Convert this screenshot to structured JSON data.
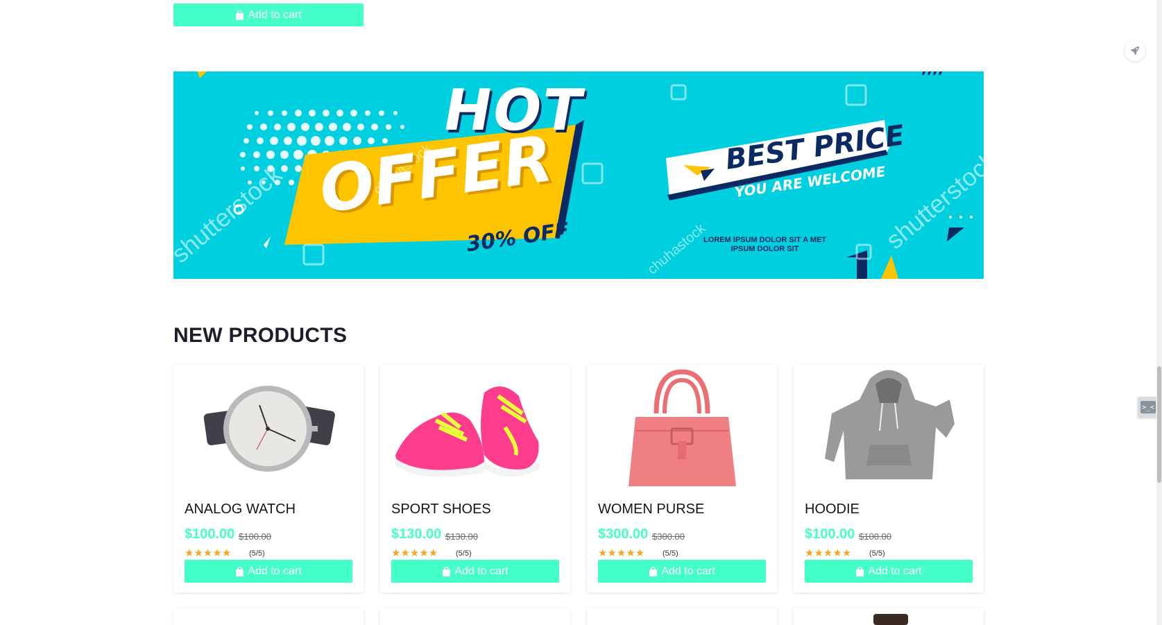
{
  "top_cart": {
    "label": "Add to cart"
  },
  "banner": {
    "hot": "HOT",
    "offer": "OFFER",
    "discount": "30% OFF",
    "best_price": "BEST PRICE",
    "welcome": "YOU ARE WELCOME",
    "lorem_line1": "LOREM IPSUM DOLOR SIT A MET",
    "lorem_line2": "IPSUM DOLOR SIT",
    "watermark_main": "shutterstock",
    "watermark_secondary": "chuhastock"
  },
  "section": {
    "title": "NEW PRODUCTS"
  },
  "products": [
    {
      "name": "ANALOG WATCH",
      "price": "$100.00",
      "old_price": "$100.00",
      "stars": "★★★★★",
      "rating": "(5/5)",
      "cart_label": "Add to cart",
      "image_icon": "watch-image"
    },
    {
      "name": "SPORT SHOES",
      "price": "$130.00",
      "old_price": "$130.00",
      "stars": "★★★★★",
      "rating": "(5/5)",
      "cart_label": "Add to cart",
      "image_icon": "shoes-image"
    },
    {
      "name": "WOMEN PURSE",
      "price": "$300.00",
      "old_price": "$300.00",
      "stars": "★★★★★",
      "rating": "(5/5)",
      "cart_label": "Add to cart",
      "image_icon": "purse-image"
    },
    {
      "name": "HOODIE",
      "price": "$100.00",
      "old_price": "$100.00",
      "stars": "★★★★★",
      "rating": "(5/5)",
      "cart_label": "Add to cart",
      "image_icon": "hoodie-image"
    }
  ],
  "widgets": {
    "rocket_icon": "rocket-icon",
    "console_icon": "console-icon",
    "console_glyph": ">_<"
  },
  "colors": {
    "accent": "#45ffc9",
    "banner_bg": "#00cfdf",
    "banner_yellow": "#ffc400",
    "banner_navy": "#0b2a63",
    "star": "#f5a623"
  }
}
